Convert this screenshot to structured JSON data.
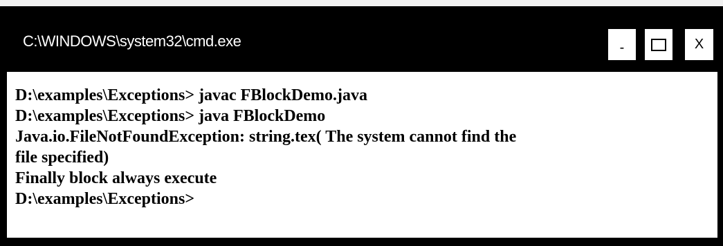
{
  "window": {
    "title": "C:\\WINDOWS\\system32\\cmd.exe",
    "buttons": {
      "minimize_label": "-",
      "close_label": "X"
    }
  },
  "console": {
    "lines": [
      "D:\\examples\\Exceptions> javac FBlockDemo.java",
      "D:\\examples\\Exceptions> java FBlockDemo",
      "Java.io.FileNotFoundException: string.tex( The system cannot find the",
      "file specified)",
      "Finally block always execute",
      "D:\\examples\\Exceptions>"
    ]
  },
  "colors": {
    "frame": "#000000",
    "console_bg": "#ffffff",
    "title_text": "#ffffff",
    "console_text": "#000000"
  }
}
